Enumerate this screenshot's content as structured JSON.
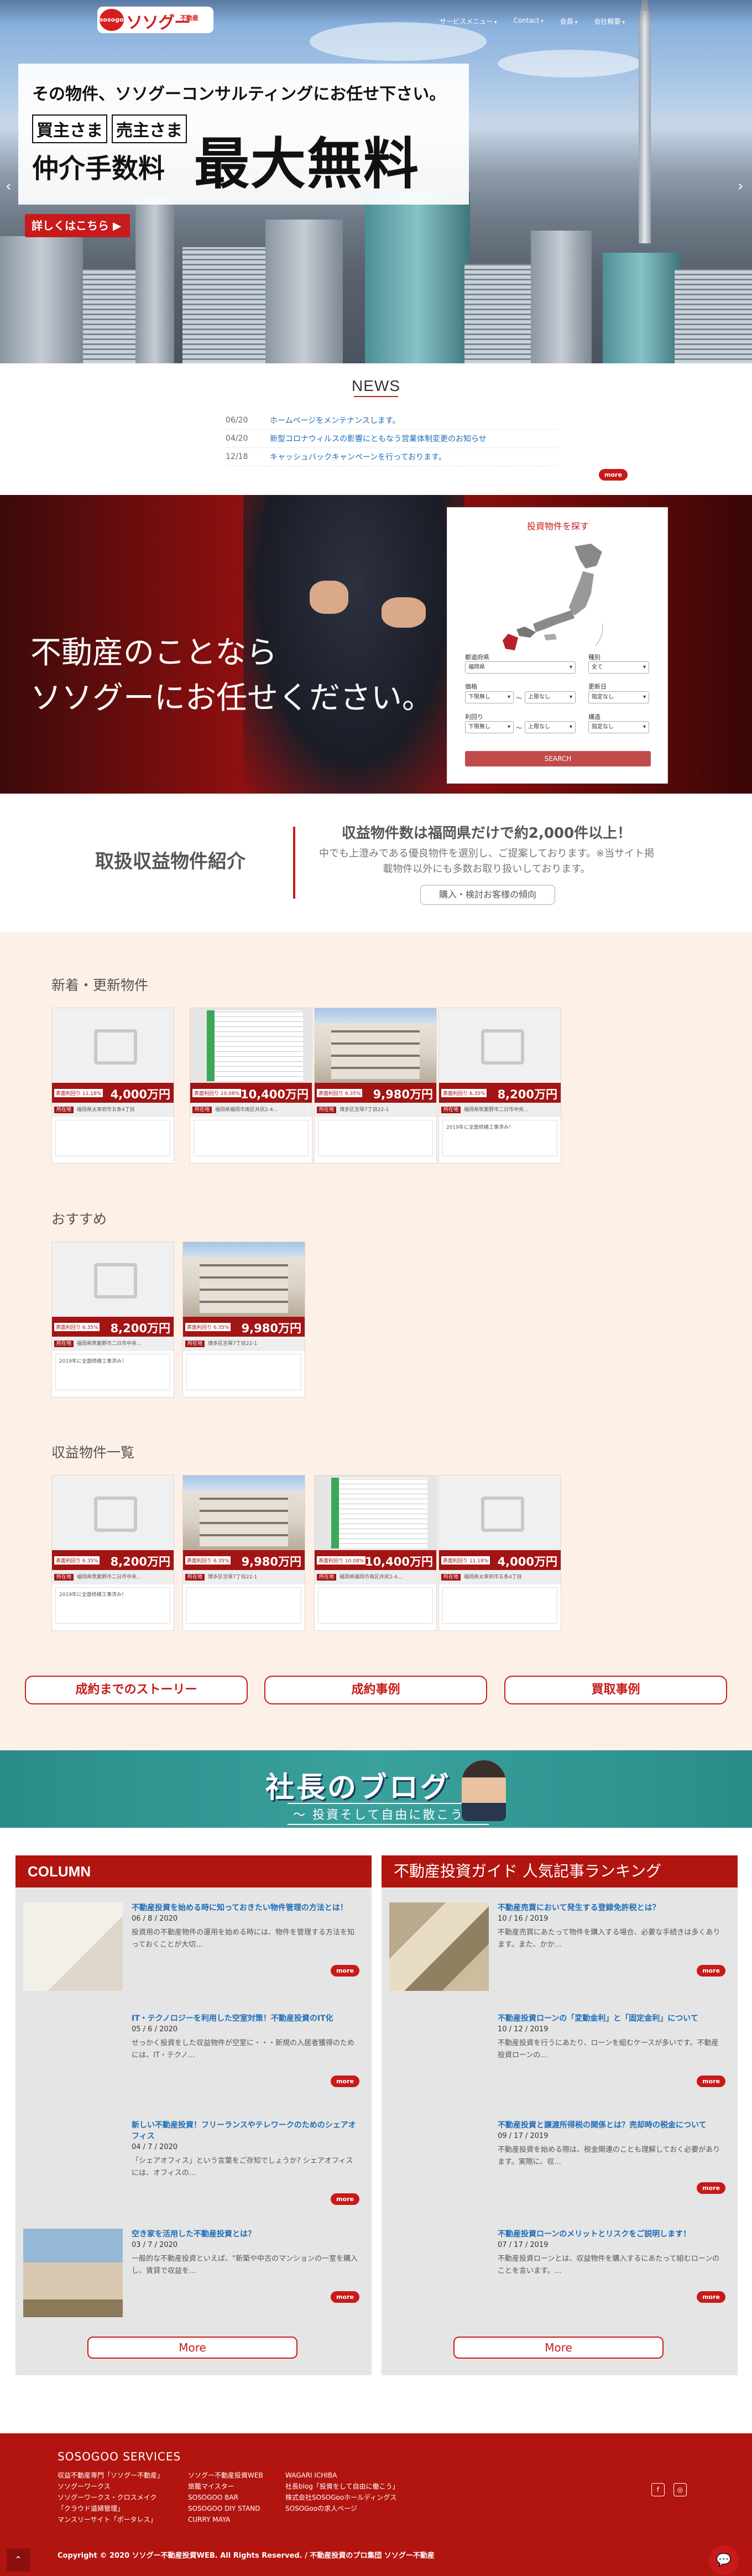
{
  "brand": {
    "logo_text": "ソソグー",
    "logo_circle": "sosogoo",
    "logo_sub": "不動産"
  },
  "nav": {
    "items": [
      "サービスメニュー",
      "Contact",
      "会員",
      "会社概要"
    ]
  },
  "hero": {
    "line1": "その物件、ソソグーコンサルティングにお任せ下さい。",
    "tag_buyer": "買主さま",
    "tag_seller": "売主さま",
    "line2": "仲介手数料",
    "big": "最大無料",
    "detail_button": "詳しくはこちら ▶"
  },
  "news": {
    "title": "NEWS",
    "items": [
      {
        "date": "06/20",
        "text": "ホームページをメンテナンスします。"
      },
      {
        "date": "04/20",
        "text": "新型コロナウィルスの影響にともなう営業体制変更のお知らせ"
      },
      {
        "date": "12/18",
        "text": "キャッシュバックキャンペーンを行っております。"
      }
    ],
    "more": "more"
  },
  "band": {
    "line1": "不動産のことなら",
    "line2": "ソソグーにお任せください。"
  },
  "search": {
    "title": "投資物件を探す",
    "pref_label": "都道府県",
    "pref_value": "福岡県",
    "type_label": "種別",
    "type_value": "全て",
    "price_label": "価格",
    "price_min": "下限無し",
    "price_max": "上限なし",
    "renew_label": "更新日",
    "renew_value": "指定なし",
    "yield_label": "利回り",
    "yield_min": "下限無し",
    "yield_max": "上限なし",
    "struct_label": "構造",
    "struct_value": "指定なし",
    "tilde": "〜",
    "button": "SEARCH"
  },
  "intro": {
    "title": "取扱収益物件紹介",
    "heading": "収益物件数は福岡県だけで約2,000件以上！",
    "text": "中でも上澄みである優良物件を選別し、ご提案しております。※当サイト掲載物件以外にも多数お取り扱いしております。",
    "button": "購入・検討お客様の傾向"
  },
  "listings": {
    "new_title": "新着・更新物件",
    "recommend_title": "おすすめ",
    "all_title": "収益物件一覧",
    "cards": [
      {
        "yield": "表面利回り 11.18%",
        "price": "4,000万円",
        "addr": "福岡県太宰府市五条4丁目",
        "note": ""
      },
      {
        "yield": "表面利回り 10.08%",
        "price": "10,400万円",
        "addr": "福岡県福岡市南区井尻2-4...",
        "note": ""
      },
      {
        "yield": "表面利回り 6.35%",
        "price": "9,980万円",
        "addr": "博多区吉塚7丁目22-1",
        "note": ""
      },
      {
        "yield": "表面利回り 6.35%",
        "price": "8,200万円",
        "addr": "福岡県筑紫野市二日市中央...",
        "note": "2019年に全面修繕工事済み！"
      }
    ],
    "tag": "所在地"
  },
  "buttons": {
    "story": "成約までのストーリー",
    "cases": "成約事例",
    "buy": "買取事例"
  },
  "blog": {
    "title": "社長のブログ",
    "subtitle": "〜 投資そして自由に散こう 〜"
  },
  "column": {
    "title": "COLUMN",
    "items": [
      {
        "title": "不動産投資を始める時に知っておきたい物件管理の方法とは！",
        "date": "06 / 8 / 2020",
        "text": "投資用の不動産物件の運用を始める時には、物件を管理する方法を知っておくことが大切..."
      },
      {
        "title": "IT・テクノロジーを利用した空室対策！不動産投資のIT化",
        "date": "05 / 6 / 2020",
        "text": "せっかく投資をした収益物件が空室に・・・新規の入居者獲得のためには、IT・テクノ..."
      },
      {
        "title": "新しい不動産投資！フリーランスやテレワークのためのシェアオフィス",
        "date": "04 / 7 / 2020",
        "text": "「シェアオフィス」という言葉をご存知でしょうか? シェアオフィスには、オフィスの..."
      },
      {
        "title": "空き家を活用した不動産投資とは？",
        "date": "03 / 7 / 2020",
        "text": "一般的な不動産投資といえば、\"新築や中古のマンションの一室を購入し、賃貸で収益を..."
      }
    ],
    "more": "more",
    "big_more": "More"
  },
  "ranking": {
    "title": "不動産投資ガイド 人気記事ランキング",
    "items": [
      {
        "title": "不動産売買において発生する登録免許税とは？",
        "date": "10 / 16 / 2019",
        "text": "不動産売買にあたって物件を購入する場合、必要な手続きは多くあります。また、かか..."
      },
      {
        "title": "不動産投資ローンの「変動金利」と「固定金利」について",
        "date": "10 / 12 / 2019",
        "text": "不動産投資を行うにあたり、ローンを組むケースが多いです。不動産投資ローンの..."
      },
      {
        "title": "不動産投資と譲渡所得税の関係とは？売却時の税金について",
        "date": "09 / 17 / 2019",
        "text": "不動産投資を始める際は、税金関連のことも理解しておく必要があります。実際に、収..."
      },
      {
        "title": "不動産投資ローンのメリットとリスクをご説明します！",
        "date": "07 / 17 / 2019",
        "text": "不動産投資ローンとは、収益物件を購入するにあたって組むローンのことを言います。..."
      }
    ],
    "more": "more",
    "big_more": "More"
  },
  "footer": {
    "title": "SOSOGOO SERVICES",
    "col1": [
      "収益不動産専門「ソソグー不動産」",
      "ソソグーワークス",
      "ソソグーワークス・クロスメイク",
      "「クラウド道婦管理」",
      "マンスリーサイト「ポータレス」"
    ],
    "col2": [
      "ソソグー不動産投資WEB",
      "旅籠マイスター",
      "SOSOGOO BAR",
      "SOSOGOO DIY STAND",
      "CURRY MAYA"
    ],
    "col3": [
      "WAGARI ICHIBA",
      "社長blog「投資をして自由に働こう」",
      "株式会社SOSOGooホールディングス",
      "SOSOGooの求人ページ"
    ],
    "copyright": "Copyright © 2020 ソソグー不動産投資WEB. All Rights Reserved. / 不動産投資のプロ集団 ソソグー不動産"
  }
}
